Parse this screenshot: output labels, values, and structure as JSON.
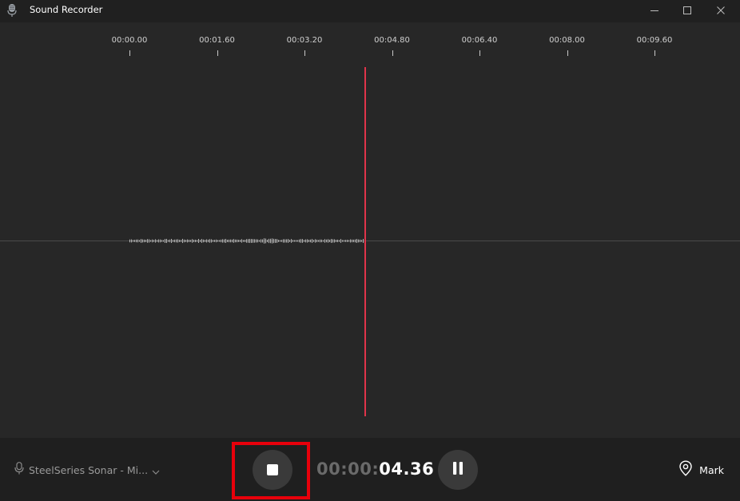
{
  "window": {
    "title": "Sound Recorder",
    "icons": {
      "app": "microphone-app-icon",
      "minimize": "minimize-icon",
      "maximize": "maximize-icon",
      "close": "close-icon"
    }
  },
  "timeline": {
    "ticks": [
      "00:00.00",
      "00:01.60",
      "00:03.20",
      "00:04.80",
      "00:06.40",
      "00:08.00",
      "00:09.60"
    ],
    "playhead_seconds": 4.36,
    "playhead_color": "#e0344a",
    "waveform_color": "#bdbdbd"
  },
  "controls": {
    "input_device": "SteelSeries Sonar - Mi...",
    "timer_dim": "00:00:",
    "timer_value": "04.36",
    "mark_label": "Mark",
    "icons": {
      "device": "microphone-icon",
      "device_dropdown": "chevron-down-icon",
      "stop": "stop-icon",
      "pause": "pause-icon",
      "mark": "location-pin-icon"
    },
    "highlight_color": "#e8000b"
  }
}
